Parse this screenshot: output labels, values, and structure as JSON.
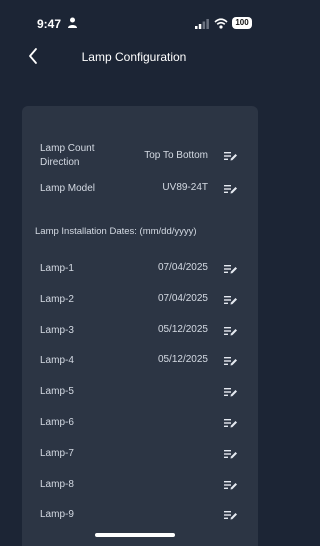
{
  "status_bar": {
    "time": "9:47",
    "battery": "100"
  },
  "header": {
    "title": "Lamp Configuration"
  },
  "config": {
    "lamp_count_direction": {
      "label": "Lamp Count\nDirection",
      "value": "Top To Bottom"
    },
    "lamp_model": {
      "label": "Lamp Model",
      "value": "UV89-24T"
    }
  },
  "install_dates": {
    "header": "Lamp Installation Dates: (mm/dd/yyyy)",
    "lamps": [
      {
        "label": "Lamp-1",
        "value": "07/04/2025"
      },
      {
        "label": "Lamp-2",
        "value": "07/04/2025"
      },
      {
        "label": "Lamp-3",
        "value": "05/12/2025"
      },
      {
        "label": "Lamp-4",
        "value": "05/12/2025"
      },
      {
        "label": "Lamp-5",
        "value": ""
      },
      {
        "label": "Lamp-6",
        "value": ""
      },
      {
        "label": "Lamp-7",
        "value": ""
      },
      {
        "label": "Lamp-8",
        "value": ""
      },
      {
        "label": "Lamp-9",
        "value": ""
      }
    ]
  },
  "icons": {
    "back": "chevron-left-icon",
    "edit": "edit-list-icon",
    "person": "person-icon",
    "signal": "signal-icon",
    "wifi": "wifi-icon",
    "battery": "battery-icon"
  },
  "colors": {
    "background": "#1c2535",
    "card": "#2c3544",
    "text": "#d4dae3"
  }
}
